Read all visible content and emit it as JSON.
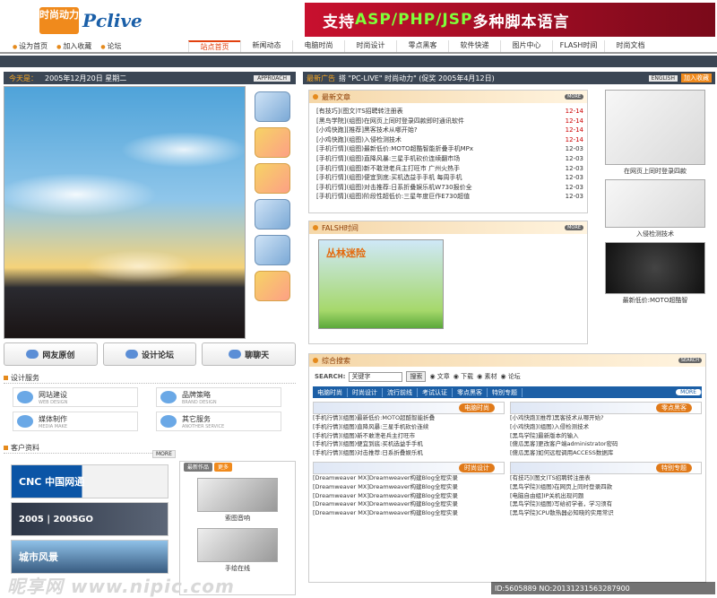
{
  "header": {
    "logo_cn": "时尚动力",
    "logo_en": "Pclive",
    "banner_prefix": "支持",
    "banner_highlight": "ASP/PHP/JSP",
    "banner_suffix": "多种脚本语言"
  },
  "util_links": [
    "设为首页",
    "加入收藏",
    "论坛"
  ],
  "nav": [
    "站点首页",
    "新闻动态",
    "电脑时尚",
    "时尚设计",
    "零点黑客",
    "软件快递",
    "图片中心",
    "FLASH时间",
    "时尚文档"
  ],
  "datebar": {
    "label": "今天是：",
    "date": "2005年12月20日 星期二",
    "tag": "APPROACH"
  },
  "ticker": {
    "ad": "最新广告",
    "text": "搭 \"PC-LIVE\" 时尚动力\"  (促奖  2005年4月12日)",
    "eng": "ENGLISH",
    "fav": "加入收藏"
  },
  "quick_buttons": [
    "网友原创",
    "设计论坛",
    "聊聊天"
  ],
  "services": {
    "title": "设计服务",
    "items": [
      {
        "name": "网站建设",
        "sub": "WEB DESIGN"
      },
      {
        "name": "品牌策略",
        "sub": "BRAND DESIGN"
      },
      {
        "name": "媒体制作",
        "sub": "MEDIA MAKE"
      },
      {
        "name": "其它服务",
        "sub": "ANOTHER SERVICE"
      }
    ]
  },
  "clients": {
    "title": "客户资料",
    "more": "MORE",
    "logos": [
      "CNC 中国网通",
      "2005 | 2005GO",
      "城市风景"
    ]
  },
  "recommend": {
    "tabs": [
      "最新作品",
      "更多"
    ],
    "items": [
      "索图音响",
      "手绘在线"
    ]
  },
  "news": {
    "title": "最新文章",
    "more": "MORE",
    "items": [
      {
        "title": "[有技巧](图文)TS招聘转注册表",
        "date": "12-14"
      },
      {
        "title": "[黑鸟学院](组图)在网页上同时登录四款即时通讯软件",
        "date": "12-14"
      },
      {
        "title": "[小鸡快跑][推荐]黑客技术从哪开始?",
        "date": "12-14"
      },
      {
        "title": "[小鸡快跑](组图)入侵检测技术",
        "date": "12-14"
      },
      {
        "title": "[手机行情](组图)最新低价:MOTO超酷智能折叠手机MPx",
        "date": "12-03"
      },
      {
        "title": "[手机行情](组图)直降风暴:三星手机砍价连续翻市场",
        "date": "12-03"
      },
      {
        "title": "[手机行情](组图)新不敢泄老兵主打旺市  广州火热手",
        "date": "12-03"
      },
      {
        "title": "[手机行情](组图)便宜到底:买机选益手手机 每周手机",
        "date": "12-03"
      },
      {
        "title": "[手机行情](组图)对击推荐:日系折叠娱乐机W730报价全",
        "date": "12-03"
      },
      {
        "title": "[手机行情](组图)阶段性超低价:三星年度巨作E730超值",
        "date": "12-03"
      }
    ]
  },
  "flash": {
    "title": "FALSH时间",
    "more": "MORE",
    "game_title": "丛林迷险"
  },
  "search": {
    "title": "综合搜索",
    "more": "SEARCH",
    "label": "SEARCH:",
    "input_value": "关键字",
    "button": "搜索",
    "options": [
      "文章",
      "下载",
      "素材",
      "论坛"
    ],
    "tabs": [
      "电脑时尚",
      "时尚设计",
      "流行前线",
      "考试认证",
      "零点黑客",
      "特别专题"
    ],
    "tabs_more": "MORE",
    "categories": [
      {
        "banner": "电脑时尚",
        "items": [
          "[手机行情](组图)最新低价:MOTO超酷智能折叠",
          "[手机行情](组图)直降风暴:三星手机砍价连续",
          "[手机行情](组图)新不敢泄老兵主打旺市",
          "[手机行情](组图)便宜到底:买机选益手手机",
          "[手机行情](组图)对击推荐:日系折叠娱乐机"
        ]
      },
      {
        "banner": "零点黑客",
        "items": [
          "[小鸡快跑][推荐]黑客技术从哪开始?",
          "[小鸡快跑](组图)入侵检测技术",
          "[黑鸟学院]最新版本的输入",
          "[傻瓜黑客]更改客户端administrator密码",
          "[傻瓜黑客]如何远程调用ACCESS数据库"
        ]
      },
      {
        "banner": "时尚设计",
        "items": [
          "[Dreamweaver MX]Dreamweaver构建Blog全程实录",
          "[Dreamweaver MX]Dreamweaver构建Blog全程实录",
          "[Dreamweaver MX]Dreamweaver构建Blog全程实录",
          "[Dreamweaver MX]Dreamweaver构建Blog全程实录",
          "[Dreamweaver MX]Dreamweaver构建Blog全程实录"
        ]
      },
      {
        "banner": "特别专题",
        "items": [
          "[有技巧](图文)TS招聘转注册表",
          "[黑鸟学院](组图)在网页上同时登录四款",
          "[电脑自由组]IP关机出现问题",
          "[黑鸟学院](组图)写给初学者，学习须有",
          "[黑鸟学院]CPU散热器必知晓的实用常识"
        ]
      }
    ]
  },
  "right_col": [
    "在网页上同时登录四款",
    "入侵检测技术",
    "最新低价:MOTO超酷智"
  ],
  "watermark": "昵享网 www.nipic.com",
  "image_id": "ID:5605889 NO:20131231563287900"
}
